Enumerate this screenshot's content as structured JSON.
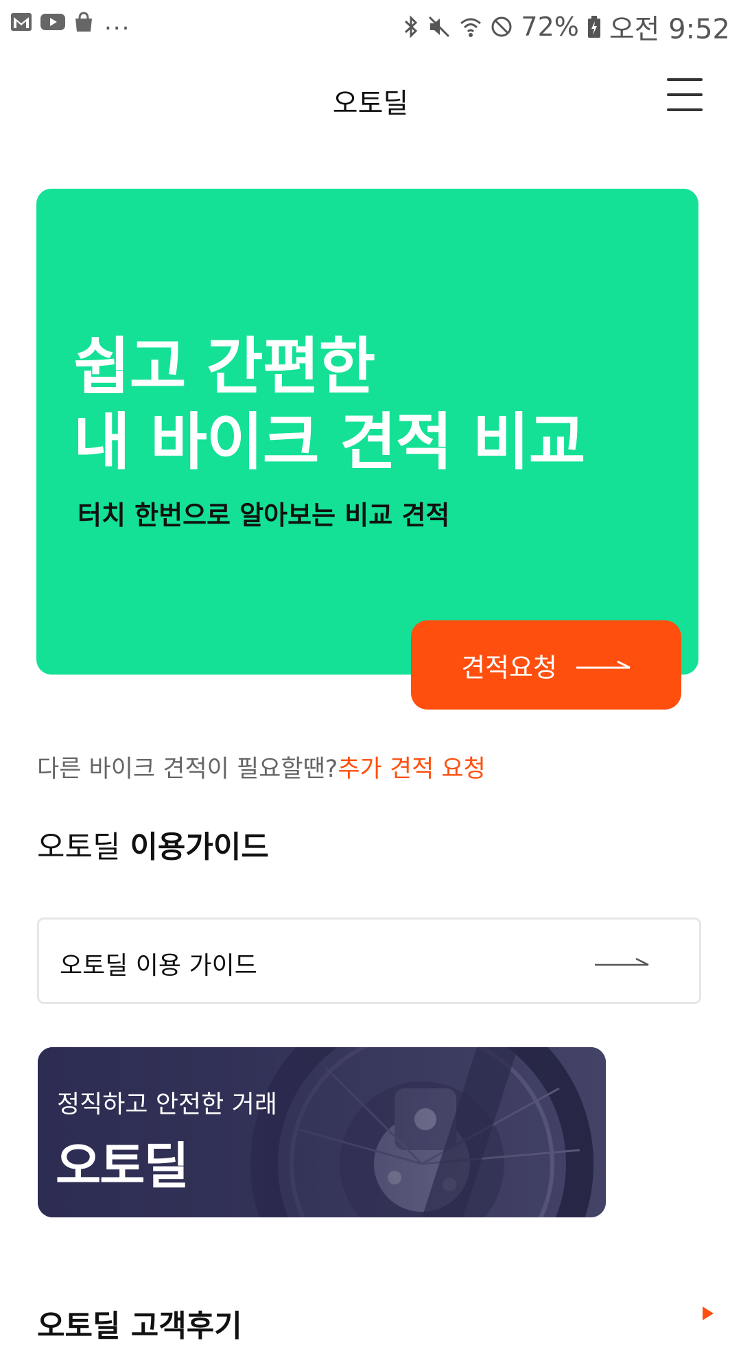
{
  "status_bar": {
    "notifications": [
      "gmail-icon",
      "youtube-icon",
      "shopping-bag-icon"
    ],
    "more": "...",
    "battery": "72%",
    "time": "오전 9:52"
  },
  "header": {
    "title": "오토딜"
  },
  "hero": {
    "title_line1": "쉽고 간편한",
    "title_line2": "내 바이크 견적 비교",
    "subtitle": "터치 한번으로 알아보는 비교 견적",
    "button_label": "견적요청",
    "background_color": "#14e196",
    "button_color": "#ff4f0f"
  },
  "extra_quote": {
    "question": "다른 바이크 견적이 필요할땐?",
    "link": "추가 견적 요청"
  },
  "guide": {
    "heading_normal": "오토딜",
    "heading_bold": "이용가이드",
    "button_label": "오토딜 이용 가이드"
  },
  "banner": {
    "subtitle": "정직하고 안전한 거래",
    "title": "오토딜"
  },
  "reviews": {
    "heading": "오토딜 고객후기"
  }
}
